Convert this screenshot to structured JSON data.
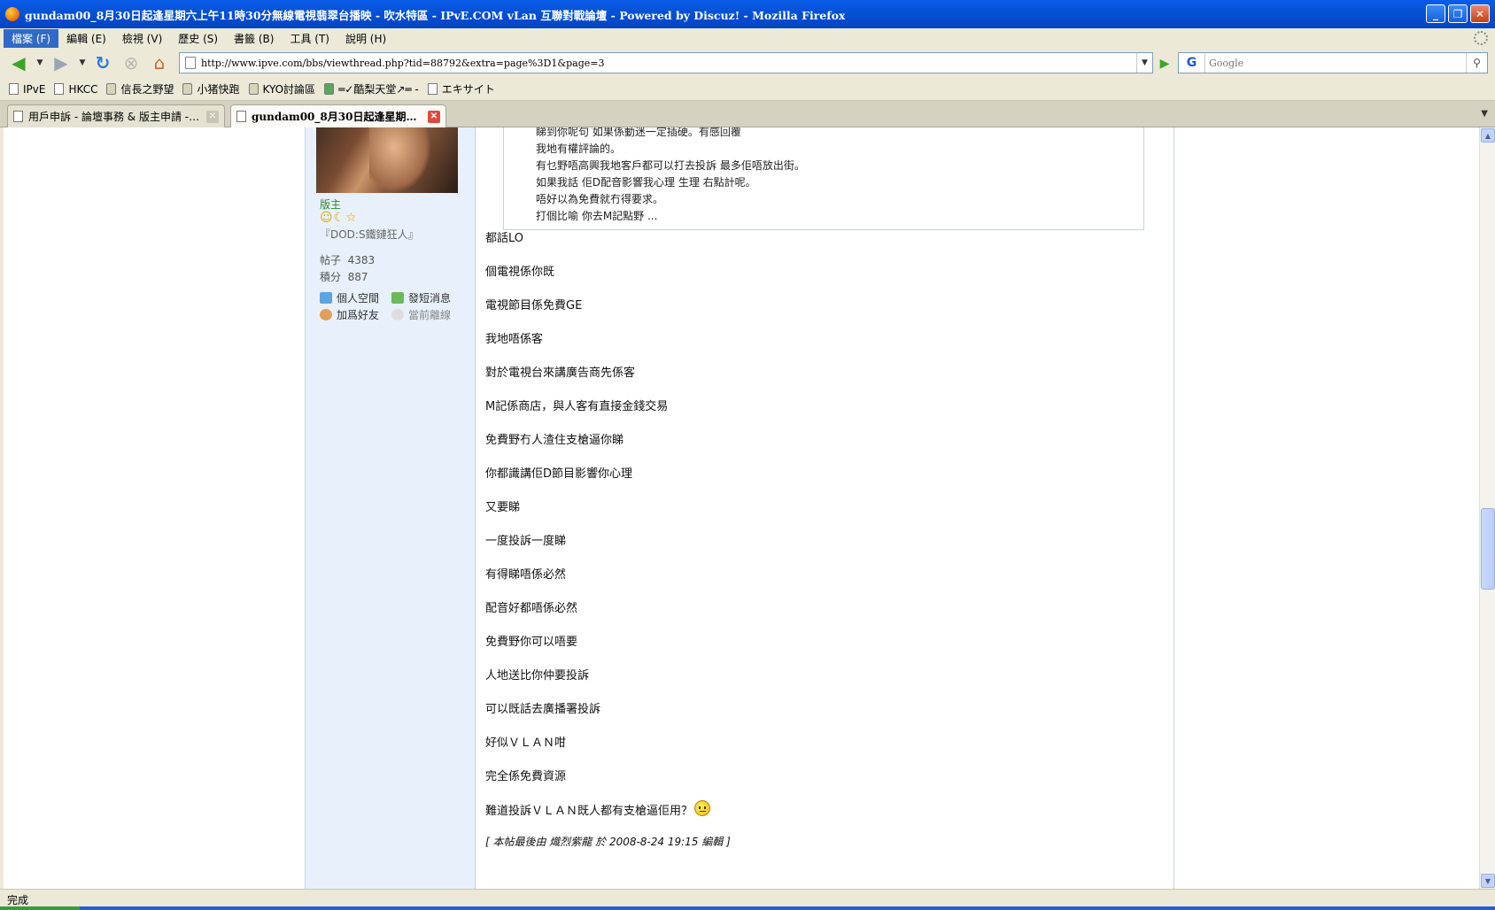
{
  "window": {
    "title": "gundam00_8月30日起逢星期六上午11時30分無線電視翡翠台播映 - 吹水特區 - IPvE.COM vLan 互聯對戰論壇 - Powered by Discuz! - Mozilla Firefox",
    "buttons": {
      "minimize": "_",
      "maximize": "❐",
      "close": "✕"
    }
  },
  "menubar": {
    "items": [
      "檔案 (F)",
      "編輯 (E)",
      "檢視 (V)",
      "歷史 (S)",
      "書籤 (B)",
      "工具 (T)",
      "說明 (H)"
    ]
  },
  "navbar": {
    "url": "http://www.ipve.com/bbs/viewthread.php?tid=88792&extra=page%3D1&page=3",
    "search_placeholder": "Google",
    "search_engine_letter": "G"
  },
  "bookmarks": [
    "IPvE",
    "HKCC",
    "信長之野望",
    "小猪快跑",
    "KYO討論區",
    "═✓酷梨天堂↗═ -",
    "エキサイト"
  ],
  "tabs": [
    {
      "title": "用戶申訴 - 論壇事務 & 版主申請 - I..."
    },
    {
      "title": "gundam00_8月30日起逢星期六..."
    }
  ],
  "user_panel": {
    "rank": "版主",
    "stars": "☺☾☆",
    "custom_title": "『DOD:S鐵鏈狂人』",
    "posts_label": "帖子",
    "posts": "4383",
    "credits_label": "積分",
    "credits": "887",
    "link_space": "個人空間",
    "link_pm": "發短消息",
    "link_friend": "加爲好友",
    "link_status": "當前離線"
  },
  "quote_lines": [
    "睇到你呢句 如果係動迷一定插硬。有感回覆",
    "我地有權評論的。",
    "有乜野唔高興我地客戶都可以打去投訴 最多佢唔放出街。",
    "如果我話 佢D配音影響我心理 生理 右點計呢。",
    "唔好以為免費就冇得要求。",
    "打個比喻 你去M記點野 ..."
  ],
  "post_lines": [
    "都話LO",
    "個電視係你既",
    "電視節目係免費GE",
    "我地唔係客",
    "對於電視台來講廣告商先係客",
    "M記係商店，與人客有直接金錢交易",
    "免費野冇人渣住支槍逼你睇",
    "你都識講佢D節目影響你心理",
    "又要睇",
    "一度投訴一度睇",
    "有得睇唔係必然",
    "配音好都唔係必然",
    "免費野你可以唔要",
    "人地送比你仲要投訴",
    "可以既話去廣播署投訴",
    "好似ＶＬＡＮ咁",
    "完全係免費資源",
    "難道投訴ＶＬＡＮ既人都有支槍逼佢用？"
  ],
  "edit_note": "[ 本帖最後由 熾烈紫龍 於 2008-8-24 19:15 編輯 ]",
  "status": {
    "text": "完成"
  }
}
